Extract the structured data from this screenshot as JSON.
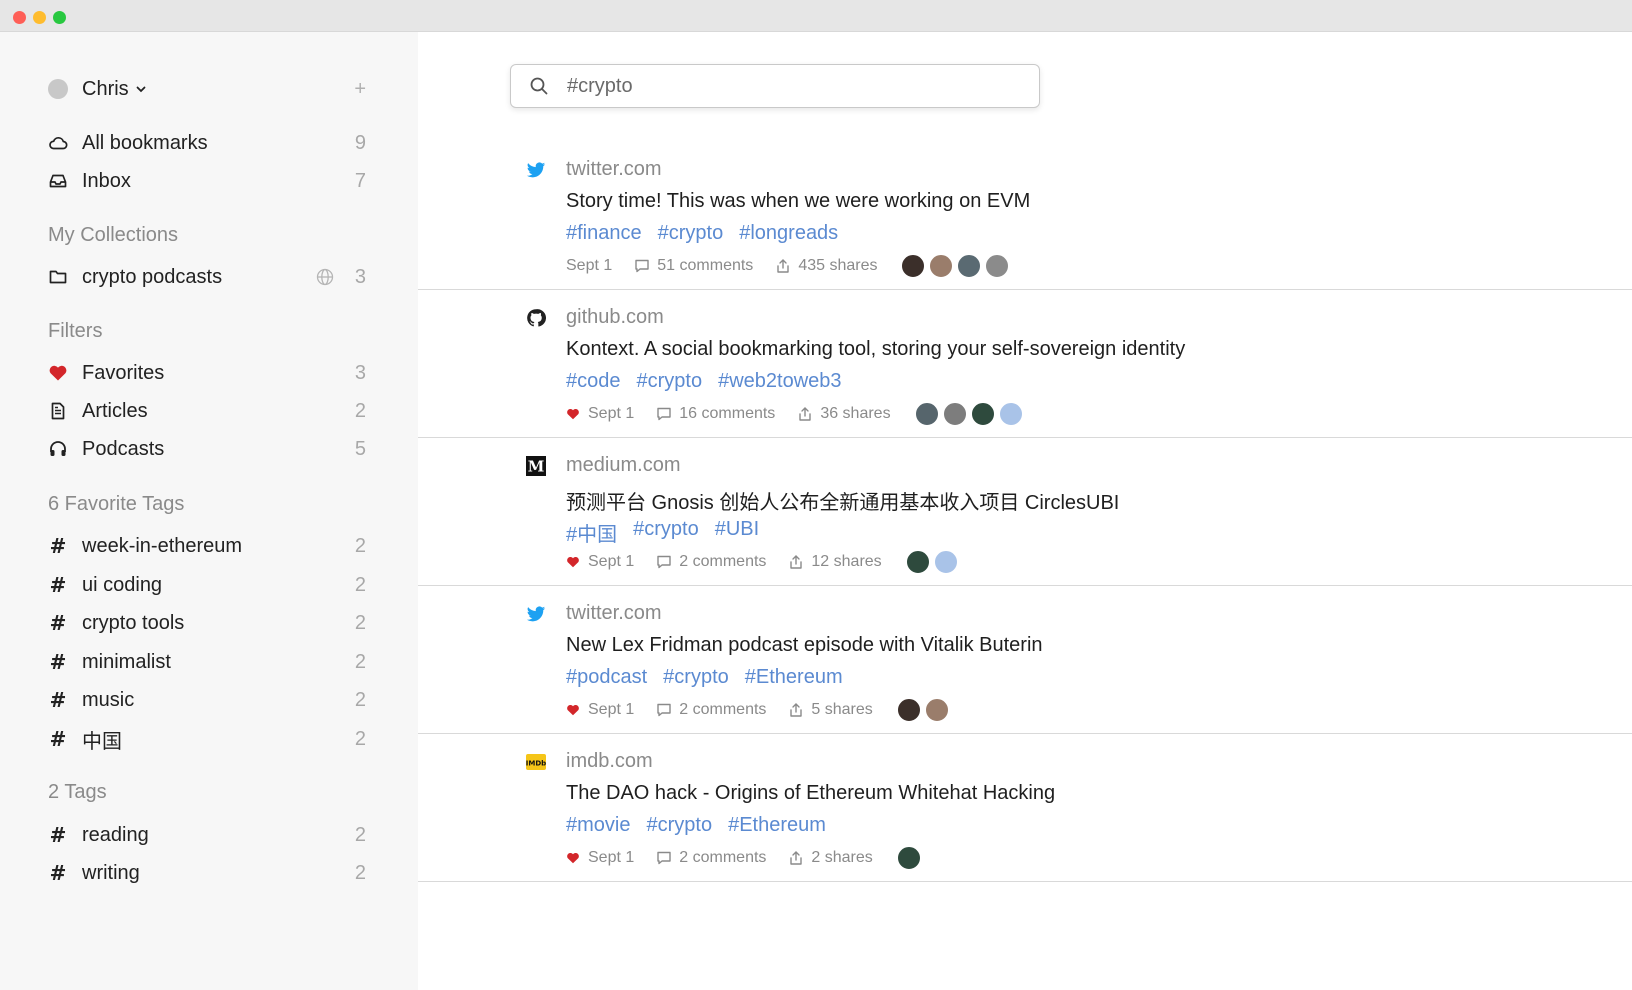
{
  "sidebar": {
    "user": {
      "name": "Chris",
      "add_label": "+"
    },
    "nav": [
      {
        "label": "All bookmarks",
        "count": "9",
        "icon": "cloud-icon"
      },
      {
        "label": "Inbox",
        "count": "7",
        "icon": "inbox-icon"
      }
    ],
    "collections_heading": "My Collections",
    "collections": [
      {
        "label": "crypto podcasts",
        "count": "3",
        "icon": "folder-icon"
      }
    ],
    "filters_heading": "Filters",
    "filters": [
      {
        "label": "Favorites",
        "count": "3",
        "icon": "heart-icon"
      },
      {
        "label": "Articles",
        "count": "2",
        "icon": "document-icon"
      },
      {
        "label": "Podcasts",
        "count": "5",
        "icon": "headphones-icon"
      }
    ],
    "fav_tags_heading": "6 Favorite Tags",
    "fav_tags": [
      {
        "label": "week-in-ethereum",
        "count": "2"
      },
      {
        "label": "ui coding",
        "count": "2"
      },
      {
        "label": "crypto tools",
        "count": "2"
      },
      {
        "label": "minimalist",
        "count": "2"
      },
      {
        "label": "music",
        "count": "2"
      },
      {
        "label": "中国",
        "count": "2"
      }
    ],
    "tags_heading": "2 Tags",
    "tags": [
      {
        "label": "reading",
        "count": "2"
      },
      {
        "label": "writing",
        "count": "2"
      }
    ]
  },
  "search": {
    "value": "#crypto"
  },
  "results": [
    {
      "domain": "twitter.com",
      "icon": "twitter-icon",
      "title": "Story time! This was when we were working on EVM",
      "tags": [
        "#finance",
        "#crypto",
        "#longreads"
      ],
      "favorite": false,
      "date": "Sept 1",
      "comments": "51 comments",
      "shares": "435 shares",
      "avatars": [
        "#3b2f2a",
        "#9a7d6b",
        "#5a6a72",
        "#8b8b8b"
      ]
    },
    {
      "domain": "github.com",
      "icon": "github-icon",
      "title": "Kontext. A social bookmarking tool, storing your self-sovereign identity",
      "tags": [
        "#code",
        "#crypto",
        "#web2toweb3"
      ],
      "favorite": true,
      "date": "Sept 1",
      "comments": "16 comments",
      "shares": "36 shares",
      "avatars": [
        "#56656c",
        "#7d7d7d",
        "#2e4a3d",
        "#a9c3e8"
      ]
    },
    {
      "domain": "medium.com",
      "icon": "medium-icon",
      "title": "预测平台 Gnosis 创始人公布全新通用基本收入项目 CirclesUBI",
      "tags": [
        "#中国",
        "#crypto",
        "#UBI"
      ],
      "favorite": true,
      "date": "Sept 1",
      "comments": "2 comments",
      "shares": "12 shares",
      "avatars": [
        "#2e4a3d",
        "#a9c3e8"
      ]
    },
    {
      "domain": "twitter.com",
      "icon": "twitter-icon",
      "title": "New Lex Fridman podcast episode with Vitalik Buterin",
      "tags": [
        "#podcast",
        "#crypto",
        "#Ethereum"
      ],
      "favorite": true,
      "date": "Sept 1",
      "comments": "2 comments",
      "shares": "5 shares",
      "avatars": [
        "#3b2f2a",
        "#9a7d6b"
      ]
    },
    {
      "domain": "imdb.com",
      "icon": "imdb-icon",
      "title": "The DAO hack - Origins of Ethereum Whitehat Hacking",
      "tags": [
        "#movie",
        "#crypto",
        "#Ethereum"
      ],
      "favorite": true,
      "date": "Sept 1",
      "comments": "2 comments",
      "shares": "2 shares",
      "avatars": [
        "#2e4a3d"
      ]
    }
  ],
  "colors": {
    "accent": "#5b8ad1",
    "heart": "#d3262a",
    "twitter": "#1da1f2"
  }
}
